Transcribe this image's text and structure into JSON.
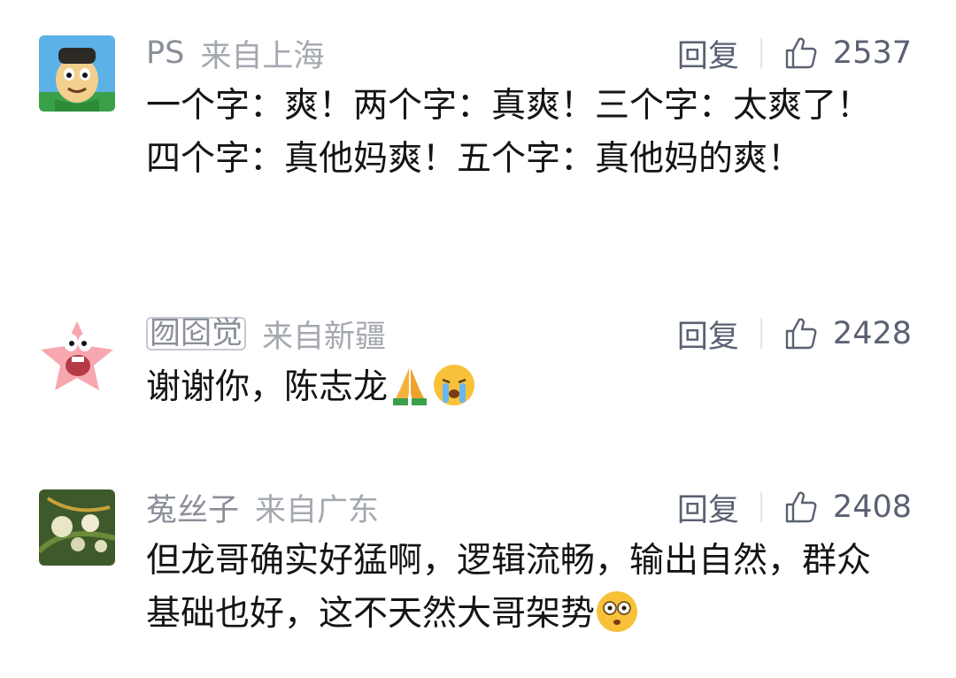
{
  "comments": [
    {
      "username": "PS",
      "location": "来自上海",
      "reply_label": "回复",
      "likes": "2537",
      "text": "一个字：爽！两个字：真爽！三个字：太爽了！四个字：真他妈爽！五个字：真他妈的爽！",
      "emojis": [],
      "avatar_icon": "cartoon-boy-avatar"
    },
    {
      "username": "囫囵觉",
      "location": "来自新疆",
      "reply_label": "回复",
      "likes": "2428",
      "text": "谢谢你，陈志龙",
      "emojis": [
        "pray-emoji",
        "crying-emoji"
      ],
      "avatar_icon": "patrick-star-avatar"
    },
    {
      "username": "菟丝子",
      "location": "来自广东",
      "reply_label": "回复",
      "likes": "2408",
      "text": "但龙哥确实好猛啊，逻辑流畅，输出自然，群众基础也好，这不天然大哥架势",
      "emojis": [
        "flushed-emoji"
      ],
      "avatar_icon": "flower-plant-avatar"
    }
  ],
  "colors": {
    "username": "#8b8f99",
    "location": "#a4a8b0",
    "action_text": "#5a6172",
    "body_text": "#141414",
    "divider": "#e3e5e9"
  }
}
